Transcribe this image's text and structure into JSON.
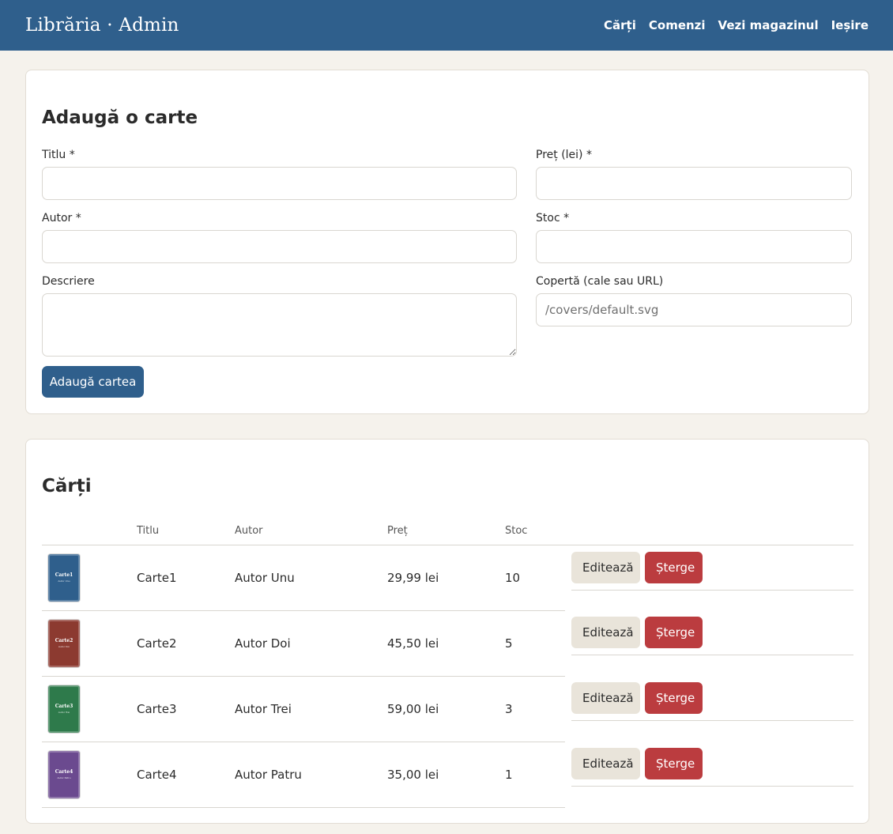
{
  "header": {
    "brand": "Librăria · Admin",
    "nav": [
      "Cărți",
      "Comenzi",
      "Vezi magazinul",
      "Ieșire"
    ]
  },
  "add_form": {
    "title": "Adaugă o carte",
    "fields": {
      "title": {
        "label": "Titlu *",
        "value": "",
        "placeholder": ""
      },
      "price": {
        "label": "Preț (lei) *",
        "value": "",
        "placeholder": ""
      },
      "author": {
        "label": "Autor *",
        "value": "",
        "placeholder": ""
      },
      "stock": {
        "label": "Stoc *",
        "value": "",
        "placeholder": ""
      },
      "description": {
        "label": "Descriere",
        "value": "",
        "placeholder": ""
      },
      "cover": {
        "label": "Copertă (cale sau URL)",
        "value": "",
        "placeholder": "/covers/default.svg"
      }
    },
    "submit_label": "Adaugă cartea"
  },
  "books": {
    "title": "Cărți",
    "columns": [
      "",
      "Titlu",
      "Autor",
      "Preț",
      "Stoc",
      ""
    ],
    "edit_label": "Editează",
    "delete_label": "Șterge",
    "rows": [
      {
        "title": "Carte1",
        "author": "Autor Unu",
        "price": "29,99 lei",
        "stock": "10",
        "cover_color": "#2f5f8c"
      },
      {
        "title": "Carte2",
        "author": "Autor Doi",
        "price": "45,50 lei",
        "stock": "5",
        "cover_color": "#8c3a30"
      },
      {
        "title": "Carte3",
        "author": "Autor Trei",
        "price": "59,00 lei",
        "stock": "3",
        "cover_color": "#2e7a4b"
      },
      {
        "title": "Carte4",
        "author": "Autor Patru",
        "price": "35,00 lei",
        "stock": "1",
        "cover_color": "#6b4a8f"
      }
    ]
  },
  "colors": {
    "primary": "#2f5f8c",
    "danger": "#bb3c3f",
    "secondary": "#e9e4da",
    "background": "#f5f2ec"
  }
}
